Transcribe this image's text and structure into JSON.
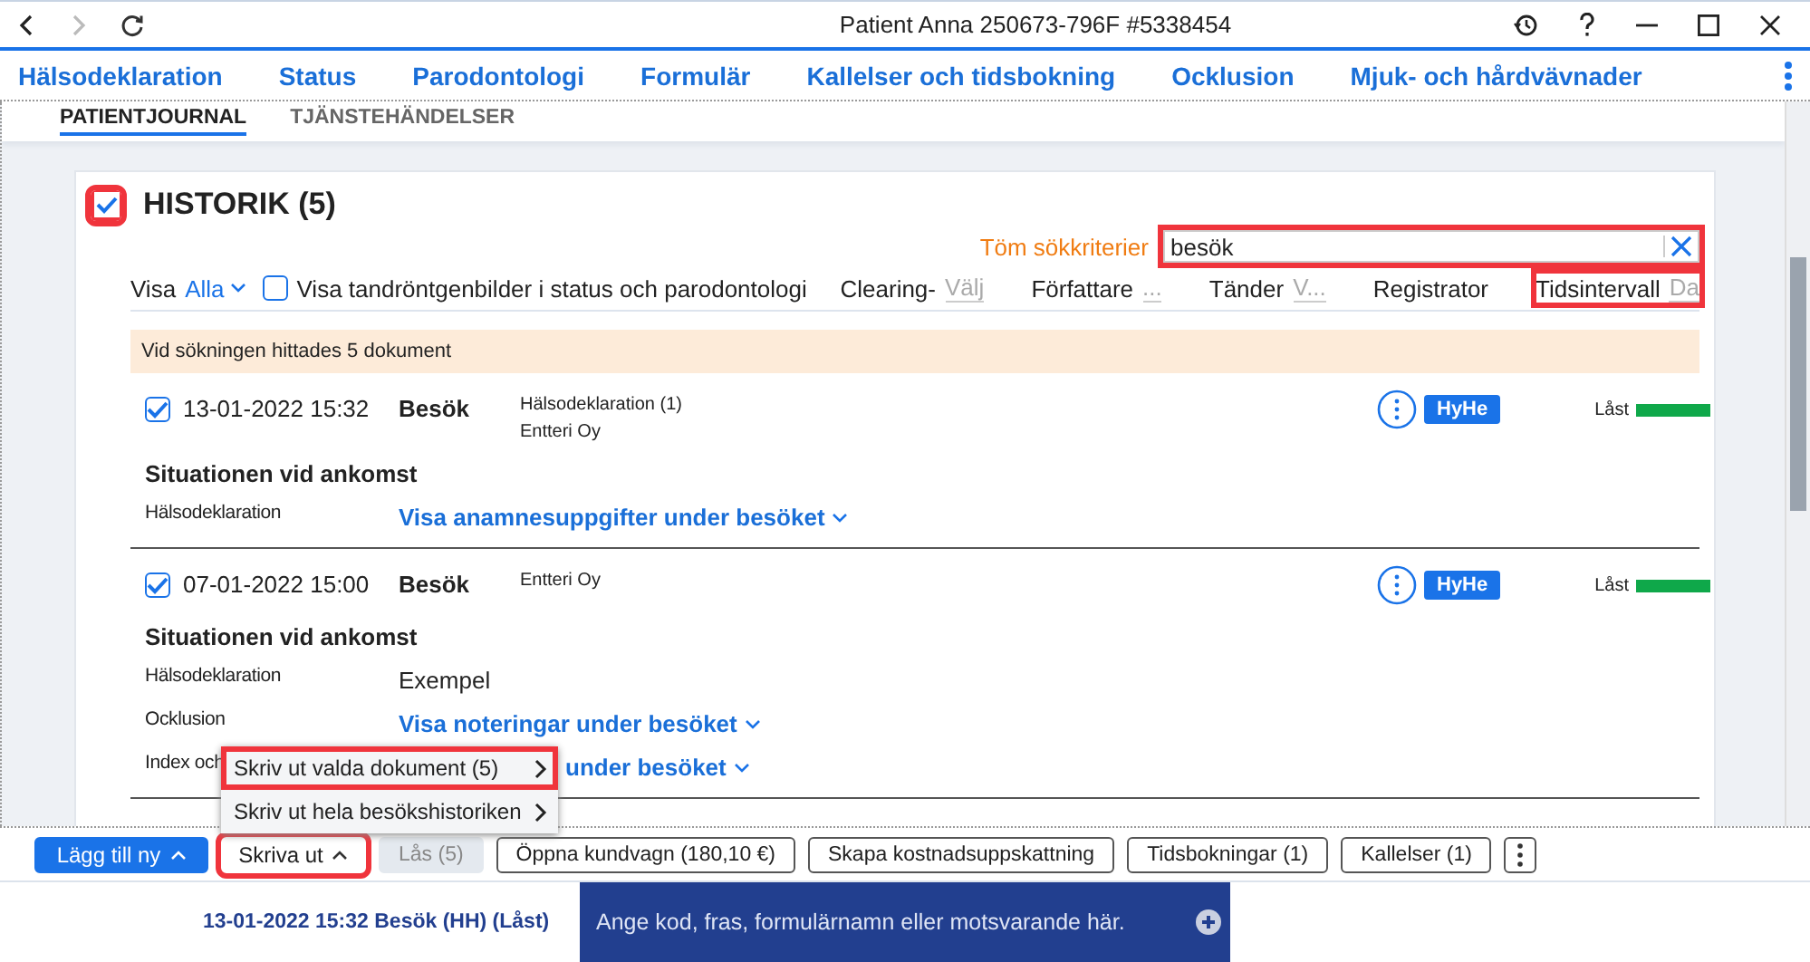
{
  "window": {
    "title": "Patient Anna 250673-796F #5338454"
  },
  "tabs": [
    {
      "label": "Hälsodeklaration"
    },
    {
      "label": "Status"
    },
    {
      "label": "Parodontologi"
    },
    {
      "label": "Formulär"
    },
    {
      "label": "Kallelser och tidsbokning"
    },
    {
      "label": "Ocklusion"
    },
    {
      "label": "Mjuk- och hårdvävnader"
    }
  ],
  "subtabs": [
    {
      "label": "PATIENTJOURNAL",
      "selected": true
    },
    {
      "label": "TJÄNSTEHÄNDELSER",
      "selected": false
    }
  ],
  "history": {
    "title": "HISTORIK (5)",
    "checked": true,
    "highlighted": true,
    "clear_link": "Töm sökkriterier",
    "search": {
      "value": "besök",
      "highlighted": true
    },
    "show_label": "Visa",
    "show_value": "Alla",
    "xray": {
      "label": "Visa tandröntgenbilder i status och parodontologi",
      "checked": false
    },
    "filters": [
      {
        "label": "Clearing-",
        "placeholder": "Välj",
        "highlighted": false
      },
      {
        "label": "Författare",
        "placeholder": "...",
        "highlighted": false
      },
      {
        "label": "Tänder",
        "placeholder": "V...",
        "highlighted": false
      },
      {
        "label": "Registrator",
        "highlighted": false
      },
      {
        "label": "Tidsintervall",
        "placeholder": "Da",
        "highlighted": true
      }
    ],
    "notice": "Vid sökningen hittades 5 dokument",
    "entries": [
      {
        "checked": true,
        "date": "13-01-2022 15:32",
        "type": "Besök",
        "details": [
          "Hälsodeklaration (1)",
          "Entteri Oy"
        ],
        "badge": "HyHe",
        "status": "Låst",
        "section": "Situationen vid ankomst",
        "rows": [
          {
            "label": "Hälsodeklaration",
            "kind": "link",
            "value": "Visa anamnesuppgifter under besöket"
          }
        ]
      },
      {
        "checked": true,
        "date": "07-01-2022 15:00",
        "type": "Besök",
        "details": [
          "Entteri Oy"
        ],
        "badge": "HyHe",
        "status": "Låst",
        "section": "Situationen vid ankomst",
        "rows": [
          {
            "label": "Hälsodeklaration",
            "kind": "text",
            "value": "Exempel"
          },
          {
            "label": "Ocklusion",
            "kind": "link",
            "value": "Visa noteringar under besöket"
          },
          {
            "label": "Index och",
            "kind": "covered-link",
            "value": "under besöket"
          }
        ]
      }
    ]
  },
  "menu": [
    {
      "label": "Skriv ut valda dokument (5)",
      "highlighted": true
    },
    {
      "label": "Skriv ut hela besökshistoriken",
      "highlighted": false
    }
  ],
  "toolbar": [
    {
      "kind": "primary",
      "label": "Lägg till ny",
      "highlighted": false
    },
    {
      "kind": "dropdown",
      "label": "Skriva ut",
      "highlighted": true
    },
    {
      "kind": "disabled",
      "label": "Lås (5)",
      "highlighted": false
    },
    {
      "kind": "outline",
      "label": "Öppna kundvagn (180,10 €)",
      "highlighted": false
    },
    {
      "kind": "outline",
      "label": "Skapa kostnadsuppskattning",
      "highlighted": false
    },
    {
      "kind": "outline",
      "label": "Tidsbokningar (1)",
      "highlighted": false
    },
    {
      "kind": "outline",
      "label": "Kallelser (1)",
      "highlighted": false
    },
    {
      "kind": "more",
      "highlighted": false
    }
  ],
  "status_bar": {
    "current": "13-01-2022 15:32 Besök (HH) (Låst)",
    "command_placeholder": "Ange kod, fras, formulärnamn eller motsvarande här."
  }
}
